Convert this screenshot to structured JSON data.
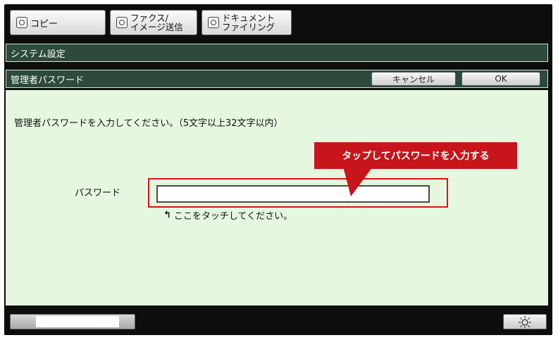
{
  "tabs": [
    {
      "label": "コピー",
      "icon": "copy-icon"
    },
    {
      "line1": "ファクス/",
      "line2": "イメージ送信",
      "icon": "fax-icon"
    },
    {
      "line1": "ドキュメント",
      "line2": "ファイリング",
      "icon": "document-filing-icon"
    }
  ],
  "system_bar": {
    "title": "システム設定"
  },
  "header": {
    "title": "管理者パスワード",
    "cancel_label": "キャンセル",
    "ok_label": "OK"
  },
  "main": {
    "instruction": "管理者パスワードを入力してください。（5文字以上32文字以内）",
    "password_label": "パスワード",
    "password_value": "",
    "hint": "ここをタッチしてください。",
    "hint_arrow": "↰"
  },
  "callout": {
    "text": "タップしてパスワードを入力する"
  },
  "colors": {
    "bar_bg": "#2d4a3c",
    "panel_bg": "#e6f7df",
    "callout": "#c8141b",
    "highlight": "#e0101a"
  },
  "bottom": {
    "brightness_icon": "brightness-icon"
  }
}
